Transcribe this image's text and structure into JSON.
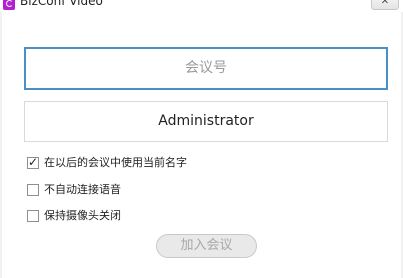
{
  "window": {
    "title": "BizConf Video",
    "close_glyph": "✕",
    "app_icon": "bizconf-logo-icon"
  },
  "form": {
    "meeting_number": {
      "value": "",
      "placeholder": "会议号"
    },
    "display_name": {
      "value": "Administrator"
    },
    "options": [
      {
        "label": "在以后的会议中使用当前名字",
        "checked": true
      },
      {
        "label": "不自动连接语音",
        "checked": false
      },
      {
        "label": "保持摄像头关闭",
        "checked": false
      }
    ],
    "join_button": {
      "label": "加入会议",
      "enabled": false
    }
  },
  "colors": {
    "accent_border": "#4a90c8",
    "app_icon": "#b21fd1"
  }
}
